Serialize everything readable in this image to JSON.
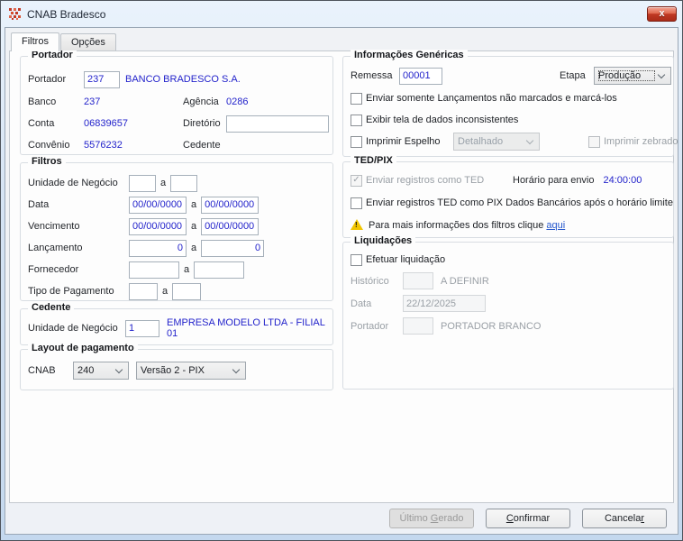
{
  "window": {
    "title": "CNAB Bradesco"
  },
  "icons": {
    "close": "x",
    "check": "✓",
    "warning": "!"
  },
  "tabs": {
    "filtros": "Filtros",
    "opcoes": "Opções"
  },
  "portador": {
    "title": "Portador",
    "portador_label": "Portador",
    "portador_value": "237",
    "portador_name": "BANCO BRADESCO S.A.",
    "banco_label": "Banco",
    "banco_value": "237",
    "agencia_label": "Agência",
    "agencia_value": "0286",
    "conta_label": "Conta",
    "conta_value": "06839657",
    "diretorio_label": "Diretório",
    "diretorio_value": "",
    "convenio_label": "Convênio",
    "convenio_value": "5576232",
    "cedente_label": "Cedente",
    "cedente_value": ""
  },
  "filtros": {
    "title": "Filtros",
    "sep": "a",
    "unidade_label": "Unidade de Negócio",
    "unidade_from": "",
    "unidade_to": "",
    "data_label": "Data",
    "data_from": "00/00/0000",
    "data_to": "00/00/0000",
    "vencimento_label": "Vencimento",
    "vencimento_from": "00/00/0000",
    "vencimento_to": "00/00/0000",
    "lancamento_label": "Lançamento",
    "lancamento_from": "0",
    "lancamento_to": "0",
    "fornecedor_label": "Fornecedor",
    "fornecedor_from": "",
    "fornecedor_to": "",
    "tipo_label": "Tipo de Pagamento",
    "tipo_from": "",
    "tipo_to": ""
  },
  "cedente": {
    "title": "Cedente",
    "unidade_label": "Unidade de Negócio",
    "unidade_value": "1",
    "empresa": "EMPRESA MODELO LTDA - FILIAL 01"
  },
  "layout_pagamento": {
    "title": "Layout de pagamento",
    "cnab_label": "CNAB",
    "cnab_value": "240",
    "versao_value": "Versão 2 - PIX"
  },
  "genericas": {
    "title": "Informações Genéricas",
    "remessa_label": "Remessa",
    "remessa_value": "00001",
    "etapa_label": "Etapa",
    "etapa_value": "Produção",
    "cb_enviar_somente": "Enviar somente Lançamentos não marcados e marcá-los",
    "cb_exibir": "Exibir tela de dados inconsistentes",
    "cb_espelho": "Imprimir Espelho",
    "espelho_modo": "Detalhado",
    "cb_zebrado": "Imprimir zebrado"
  },
  "tedpix": {
    "title": "TED/PIX",
    "cb_ted": "Enviar registros como TED",
    "horario_label": "Horário para envio",
    "horario_value": "24:00:00",
    "cb_pix": "Enviar registros TED como PIX Dados Bancários após o horário limite",
    "aviso_text": "Para mais informações dos filtros clique",
    "aviso_link": "aqui"
  },
  "liquidacoes": {
    "title": "Liquidações",
    "cb_efetuar": "Efetuar liquidação",
    "historico_label": "Histórico",
    "historico_value": "",
    "historico_desc": "A DEFINIR",
    "data_label": "Data",
    "data_value": "22/12/2025",
    "portador_label": "Portador",
    "portador_value": "",
    "portador_desc": "PORTADOR BRANCO"
  },
  "buttons": {
    "ultimo": {
      "pre": "Último ",
      "mn": "G",
      "post": "erado"
    },
    "confirmar": {
      "pre": "",
      "mn": "C",
      "post": "onfirmar"
    },
    "cancelar": {
      "pre": "Cancela",
      "mn": "r",
      "post": ""
    }
  },
  "colors": {
    "value_blue": "#2323cb",
    "link_blue": "#2456cc",
    "warning_yellow": "#f2c500",
    "close_red": "#c03a24"
  }
}
